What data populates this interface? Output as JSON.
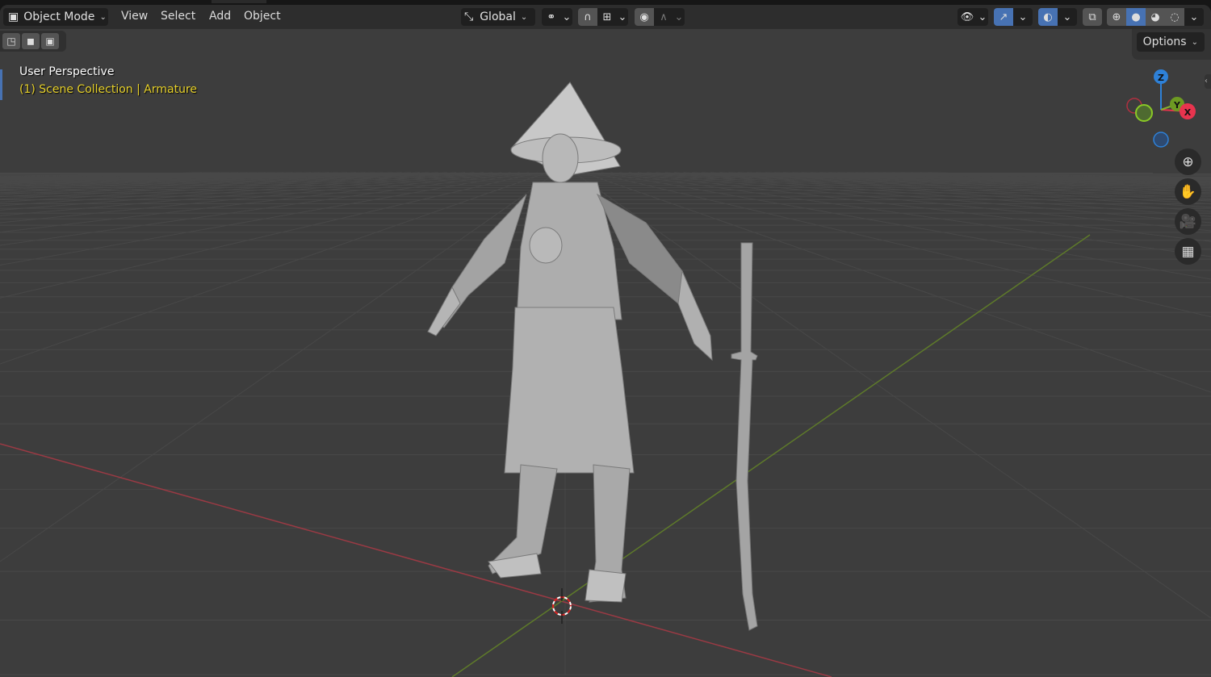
{
  "header": {
    "mode": "Object Mode",
    "menus": [
      "View",
      "Select",
      "Add",
      "Object"
    ],
    "orientation": "Global",
    "options_label": "Options"
  },
  "overlay": {
    "view_name": "User Perspective",
    "collection": "(1) Scene Collection",
    "object": "Armature"
  },
  "gizmo": {
    "z": "Z",
    "y": "Y",
    "x": "X"
  },
  "colors": {
    "accent": "#4772b3",
    "x_axis": "#e8344e",
    "y_axis": "#84b02d",
    "z_axis": "#2e81d8",
    "text_highlight": "#e6d02a"
  }
}
